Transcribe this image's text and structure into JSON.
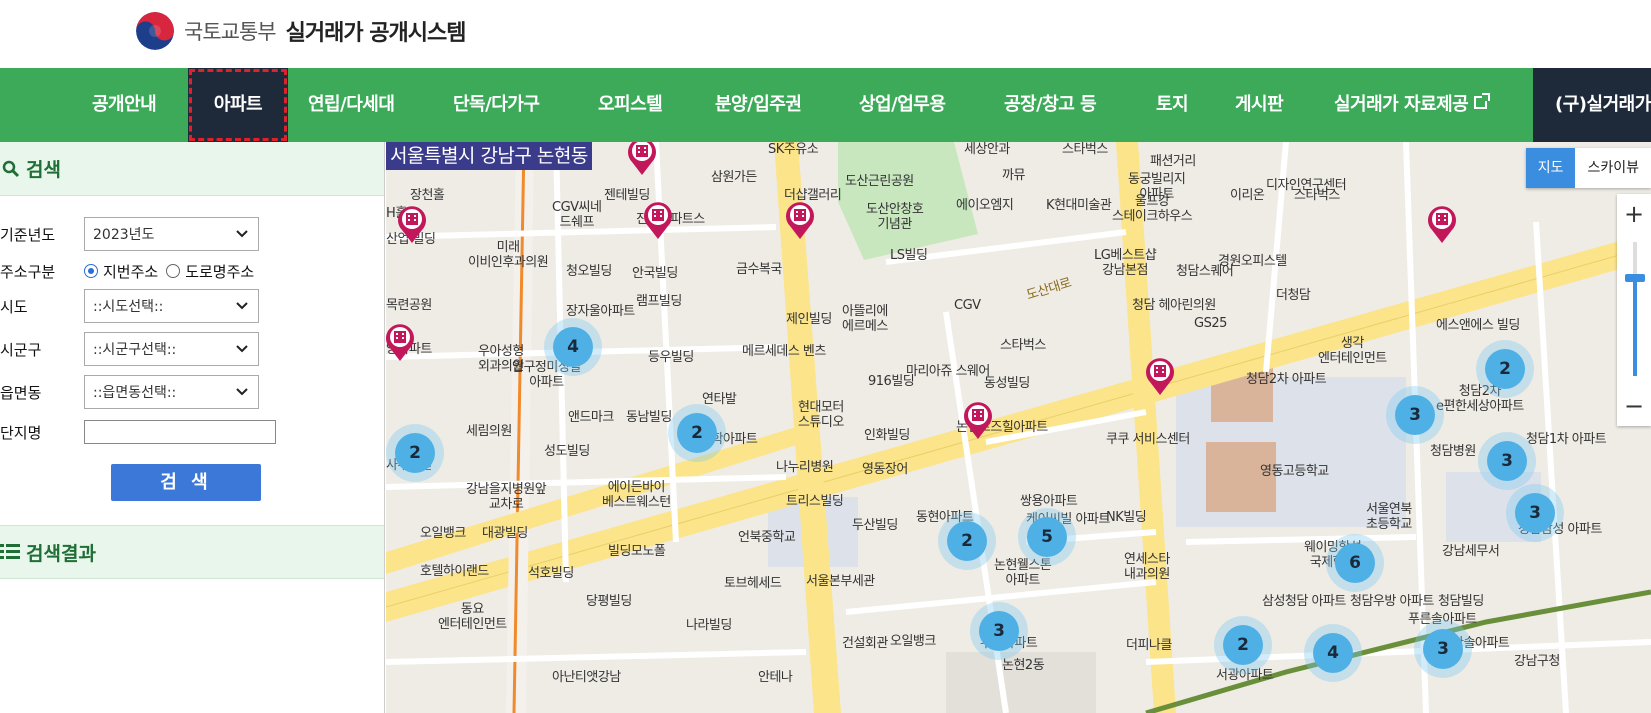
{
  "header": {
    "org": "국토교통부",
    "system": "실거래가 공개시스템"
  },
  "nav": {
    "items": [
      {
        "label": "공개안내"
      },
      {
        "label": "아파트"
      },
      {
        "label": "연립/다세대"
      },
      {
        "label": "단독/다가구"
      },
      {
        "label": "오피스텔"
      },
      {
        "label": "분양/입주권"
      },
      {
        "label": "상업/업무용"
      },
      {
        "label": "공장/창고 등"
      },
      {
        "label": "토지"
      },
      {
        "label": "게시판"
      },
      {
        "label": "실거래가 자료제공"
      },
      {
        "label": "(구)실거래가"
      }
    ],
    "active": "아파트"
  },
  "sidebar": {
    "search_title": "검색",
    "year_label": "기준년도",
    "year_value": "2023년도",
    "addr_label": "주소구분",
    "addr_opt1": "지번주소",
    "addr_opt2": "도로명주소",
    "sido_label": "시도",
    "sido_value": "::시도선택::",
    "sigungu_label": "시군구",
    "sigungu_value": "::시군구선택::",
    "emd_label": "읍면동",
    "emd_value": "::읍면동선택::",
    "complex_label": "단지명",
    "search_button": "검 색",
    "results_title": "검색결과"
  },
  "map": {
    "location": "서울특별시 강남구 논현동",
    "type_map": "지도",
    "type_sky": "스카이뷰",
    "zoom_in": "+",
    "zoom_out": "−",
    "road_label": "도산대로",
    "labels": [
      "SK주유소",
      "세상안과",
      "스타벅스",
      "패션거리",
      "삼원가든",
      "도산근린공원",
      "까뮤",
      "동궁빌리지 아파트",
      "디자인연구센터",
      "젠테빌딩",
      "CGV씨네 드쉐프",
      "진흥아파트스",
      "더샵갤러리",
      "도산안창호 기념관",
      "에이오엠지",
      "K현대미술관",
      "울프강 스테이크하우스",
      "이리온",
      "스타벅스",
      "장천홀",
      "H홀",
      "산업 빌딩",
      "미래 이비인후과의원",
      "청오빌딩",
      "안국빌딩",
      "금수복국",
      "LS빌딩",
      "LG베스트샵 강남본점",
      "청담스퀘어",
      "경원오피스텔",
      "목련공원",
      "램프빌딩",
      "제인빌딩",
      "아뜰리에 에르메스",
      "CGV",
      "청담 헤아린의원",
      "GS25",
      "더청담",
      "생각 엔터테인먼트",
      "에스앤에스 빌딩",
      "장자울아파트",
      "양아파트",
      "우아성형 외과의원",
      "압구정미성빌 아파트",
      "등우빌딩",
      "메르세데스 벤츠",
      "마리아쥬 스웨어",
      "스타벅스",
      "916빌딩",
      "동성빌딩",
      "청담2차 아파트",
      "청담2차 e편한세상아파트",
      "앤드마크",
      "동남빌딩",
      "연타발",
      "청학아파트",
      "현대모터 스튜디오",
      "인화빌딩",
      "논현로즈힐아파트",
      "쿠쿠 서비스센터",
      "청담병원",
      "청담1차 아파트",
      "세림의원",
      "성도빌딩",
      "나누리병원",
      "영동장어",
      "영동고등학교",
      "사무공원",
      "강남을지병원앞 교차로",
      "에이든바이 베스트웨스턴",
      "트리스빌딩",
      "동현아파트",
      "케이씨빌 아파트",
      "쌍용아파트",
      "NK빌딩",
      "서울연북 초등학교",
      "청담삼성 아파트",
      "오일뱅크",
      "대광빌딩",
      "빌딩모노폴",
      "언북중학교",
      "두산빌딩",
      "논현웰스톤 아파트",
      "웨이밍항성 국제학교",
      "연세스타 내과의원",
      "강남세무서",
      "호텔하이랜드",
      "석호빌딩",
      "토브헤세드",
      "서울본부세관",
      "삼성청담 아파트",
      "청담우방 아파트",
      "청담빌딩",
      "당평빌딩",
      "동요 엔터테인먼트",
      "나라빌딩",
      "건설회관",
      "오일뱅크",
      "우민아파트",
      "논현2동",
      "더피나클",
      "아난티앳강남",
      "안테나",
      "서광아파트",
      "푸른솔아파트",
      "한솔아파트",
      "강남구청"
    ],
    "clusters": [
      {
        "count": "4"
      },
      {
        "count": "2"
      },
      {
        "count": "2"
      },
      {
        "count": "2"
      },
      {
        "count": "5"
      },
      {
        "count": "3"
      },
      {
        "count": "2"
      },
      {
        "count": "6"
      },
      {
        "count": "3"
      },
      {
        "count": "3"
      },
      {
        "count": "3"
      },
      {
        "count": "2"
      },
      {
        "count": "4"
      },
      {
        "count": "3"
      }
    ]
  }
}
